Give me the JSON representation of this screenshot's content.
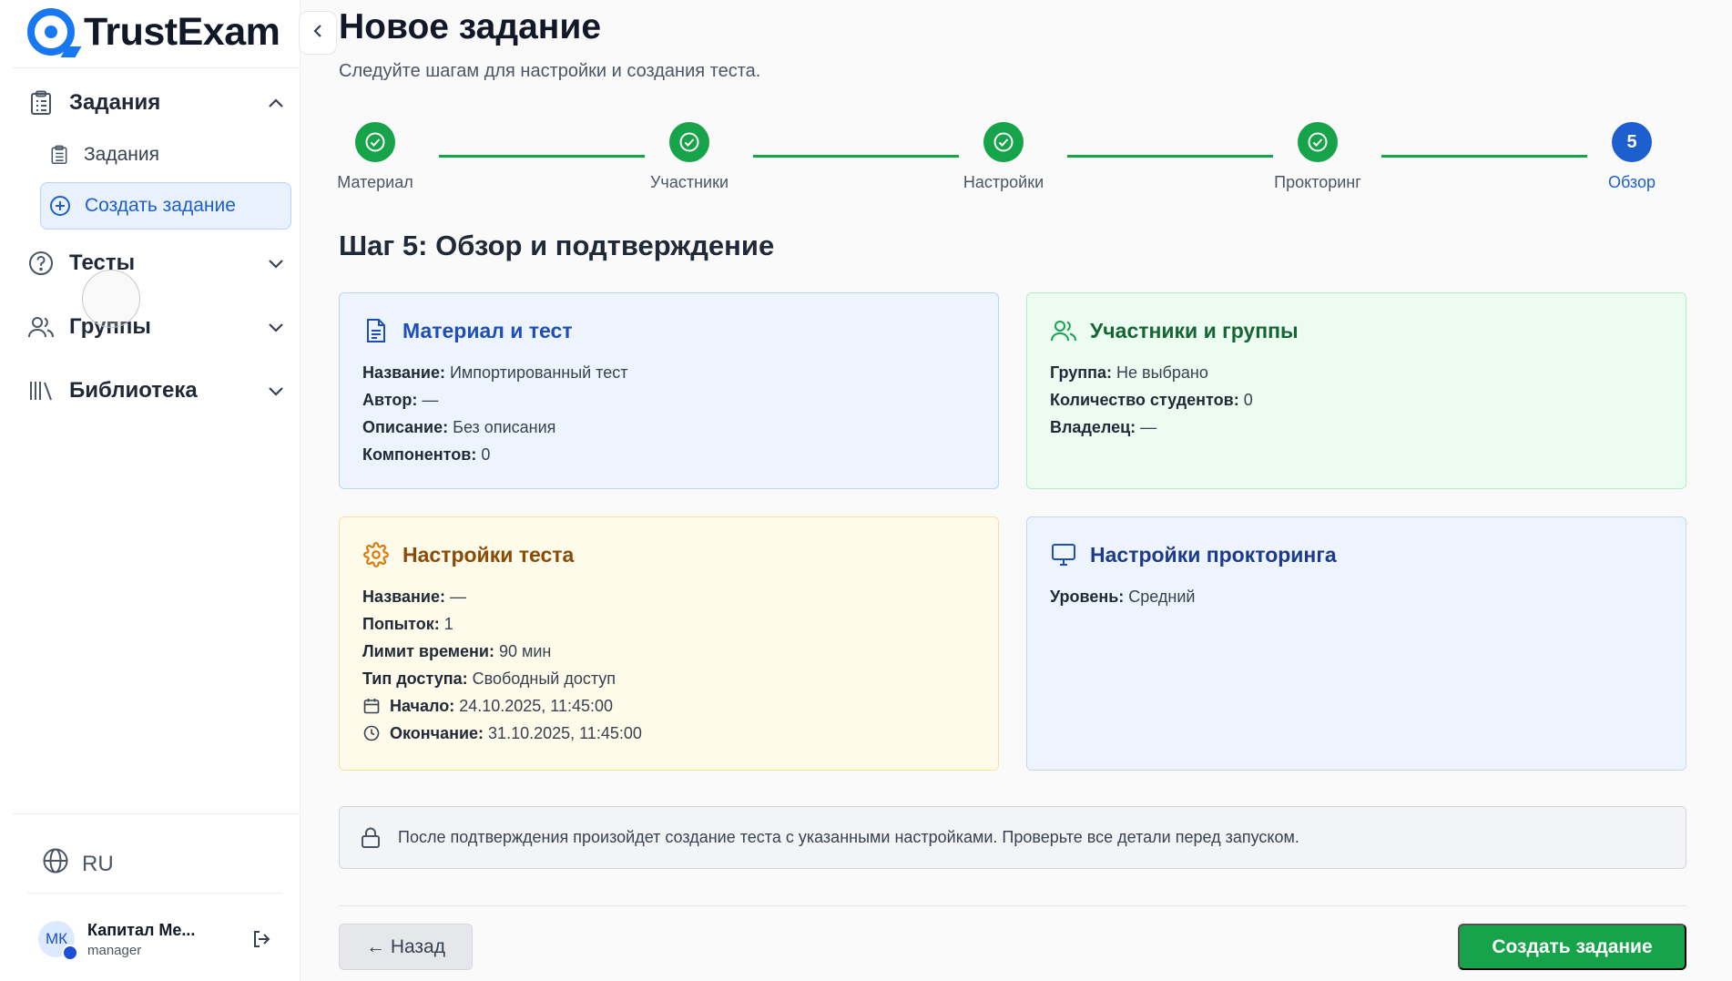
{
  "brand": {
    "name": "TrustExam",
    "accent": "#1877f2"
  },
  "sidebar": {
    "collapse_icon": "chevron-left-icon",
    "groups": [
      {
        "label": "Задания",
        "icon": "clipboard-icon",
        "chevron": "chevron-up-icon"
      },
      {
        "label": "Тесты",
        "icon": "question-circle-icon",
        "chevron": "chevron-down-icon"
      },
      {
        "label": "Группы",
        "icon": "users-icon",
        "chevron": "chevron-down-icon"
      },
      {
        "label": "Библиотека",
        "icon": "library-icon",
        "chevron": "chevron-down-icon"
      }
    ],
    "sub_items": [
      {
        "label": "Задания",
        "icon": "clipboard-icon",
        "active": false
      },
      {
        "label": "Создать задание",
        "icon": "plus-circle-icon",
        "active": true
      }
    ],
    "language": "RU",
    "user": {
      "initials": "МК",
      "name": "Капитал Ме...",
      "role": "manager"
    }
  },
  "header": {
    "title": "Новое задание",
    "subtitle": "Следуйте шагам для настройки и создания теста."
  },
  "stepper": {
    "steps": [
      {
        "label": "Материал",
        "status": "done"
      },
      {
        "label": "Участники",
        "status": "done"
      },
      {
        "label": "Настройки",
        "status": "done"
      },
      {
        "label": "Прокторинг",
        "status": "done"
      },
      {
        "label": "Обзор",
        "status": "current",
        "number": "5"
      }
    ],
    "done_color": "#16a34a",
    "current_color": "#1d5fcf"
  },
  "step_heading": "Шаг 5: Обзор и подтверждение",
  "cards": {
    "material": {
      "title": "Материал и тест",
      "icon": "document-icon",
      "rows": [
        {
          "label": "Название:",
          "value": "Импортированный тест"
        },
        {
          "label": "Автор:",
          "value": "—"
        },
        {
          "label": "Описание:",
          "value": "Без описания"
        },
        {
          "label": "Компонентов:",
          "value": "0"
        }
      ]
    },
    "participants": {
      "title": "Участники и группы",
      "icon": "users-icon",
      "rows": [
        {
          "label": "Группа:",
          "value": "Не выбрано"
        },
        {
          "label": "Количество студентов:",
          "value": "0"
        },
        {
          "label": "Владелец:",
          "value": "—"
        }
      ]
    },
    "settings": {
      "title": "Настройки теста",
      "icon": "gear-icon",
      "rows": [
        {
          "label": "Название:",
          "value": "—"
        },
        {
          "label": "Попыток:",
          "value": "1"
        },
        {
          "label": "Лимит времени:",
          "value": "90 мин"
        },
        {
          "label": "Тип доступа:",
          "value": "Свободный доступ"
        },
        {
          "label": "Начало:",
          "value": "24.10.2025, 11:45:00",
          "icon": "calendar-icon"
        },
        {
          "label": "Окончание:",
          "value": "31.10.2025, 11:45:00",
          "icon": "clock-icon"
        }
      ]
    },
    "proctoring": {
      "title": "Настройки прокторинга",
      "icon": "monitor-icon",
      "rows": [
        {
          "label": "Уровень:",
          "value": "Средний"
        }
      ]
    }
  },
  "notice": {
    "icon": "lock-icon",
    "text": "После подтверждения произойдет создание теста с указанными настройками. Проверьте все детали перед запуском."
  },
  "footer": {
    "back_label": "← Назад",
    "create_label": "Создать задание"
  }
}
